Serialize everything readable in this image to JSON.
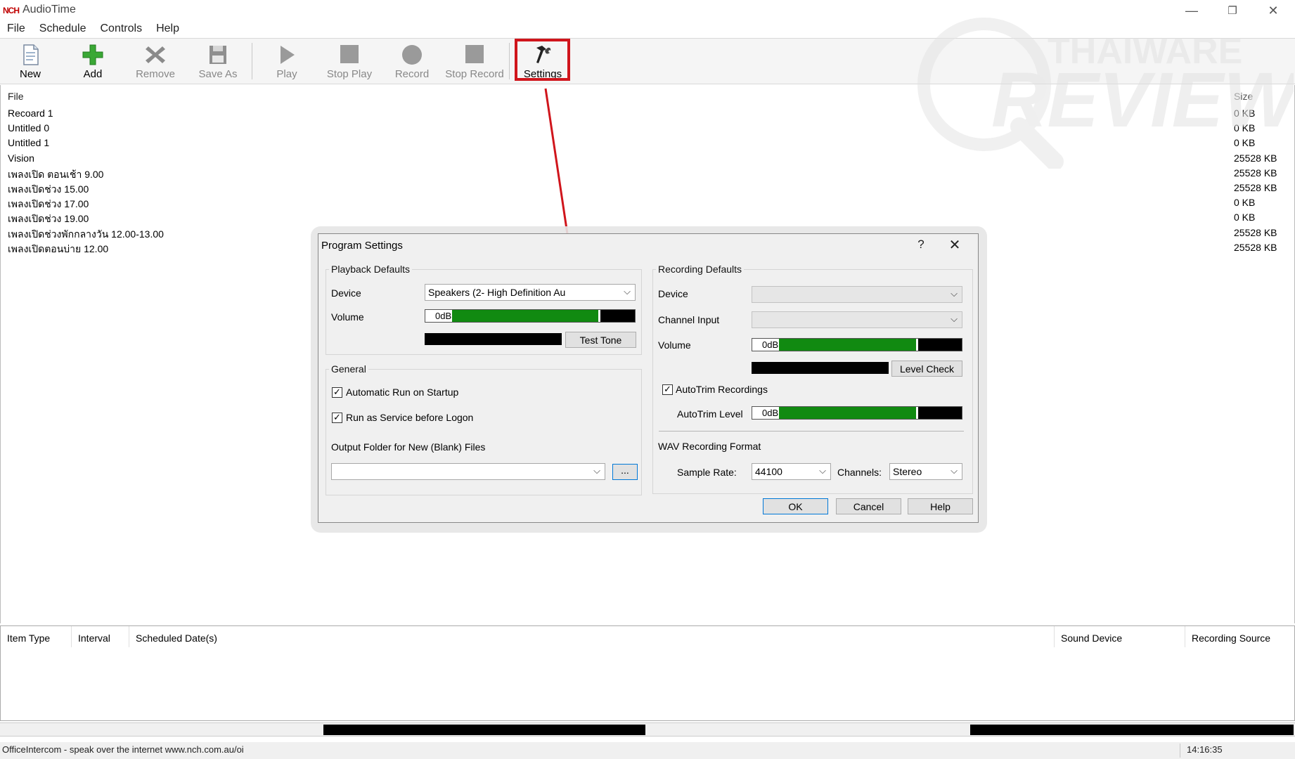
{
  "window": {
    "logo": "NCH",
    "title": "AudioTime",
    "minimize_glyph": "—",
    "restore_glyph": "❐",
    "close_glyph": "✕"
  },
  "menu": [
    "File",
    "Schedule",
    "Controls",
    "Help"
  ],
  "toolbar": {
    "new": "New",
    "add": "Add",
    "remove": "Remove",
    "save_as": "Save As",
    "play": "Play",
    "stop_play": "Stop Play",
    "record": "Record",
    "stop_record": "Stop Record",
    "settings": "Settings"
  },
  "file_list": {
    "col_file": "File",
    "col_size": "Size",
    "rows": [
      {
        "name": "Recoard 1",
        "size": "0 KB"
      },
      {
        "name": "Untitled 0",
        "size": "0 KB"
      },
      {
        "name": "Untitled 1",
        "size": "0 KB"
      },
      {
        "name": "Vision",
        "size": "25528 KB"
      },
      {
        "name": "เพลงเปิด ตอนเช้า 9.00",
        "size": "25528 KB"
      },
      {
        "name": "เพลงเปิดช่วง 15.00",
        "size": "25528 KB"
      },
      {
        "name": "เพลงเปิดช่วง 17.00",
        "size": "0 KB"
      },
      {
        "name": "เพลงเปิดช่วง 19.00",
        "size": "0 KB"
      },
      {
        "name": "เพลงเปิดช่วงพักกลางวัน 12.00-13.00",
        "size": "25528 KB"
      },
      {
        "name": "เพลงเปิดตอนบ่าย 12.00",
        "size": "25528 KB"
      }
    ]
  },
  "schedule": {
    "headers": [
      "Item Type",
      "Interval",
      "Scheduled Date(s)",
      "Sound Device",
      "Recording Source"
    ]
  },
  "status": {
    "message": "OfficeIntercom - speak over the internet www.nch.com.au/oi",
    "time": "14:16:35"
  },
  "watermark": {
    "brand": "THAIWARE",
    "word": "REVIEW"
  },
  "dialog": {
    "title": "Program Settings",
    "help_glyph": "?",
    "close_glyph": "✕",
    "playback": {
      "group": "Playback Defaults",
      "device_label": "Device",
      "device_value": "Speakers (2- High Definition Au",
      "volume_label": "Volume",
      "volume_db": "0dB",
      "volume_level": 0.81,
      "test_tone": "Test Tone"
    },
    "general": {
      "group": "General",
      "auto_run": {
        "label": "Automatic Run on Startup",
        "checked": true
      },
      "run_service": {
        "label": "Run as Service before Logon",
        "checked": true
      },
      "output_label": "Output Folder for New (Blank) Files",
      "output_value": "",
      "browse": "..."
    },
    "recording": {
      "group": "Recording Defaults",
      "device_label": "Device",
      "device_value": "",
      "channel_label": "Channel Input",
      "channel_value": "",
      "volume_label": "Volume",
      "volume_db": "0dB",
      "volume_level": 0.76,
      "level_check": "Level Check",
      "autotrim": {
        "label": "AutoTrim Recordings",
        "checked": true
      },
      "autotrim_level_label": "AutoTrim Level",
      "autotrim_db": "0dB",
      "autotrim_level": 0.76,
      "wav_label": "WAV Recording Format",
      "sample_rate_label": "Sample Rate:",
      "sample_rate_value": "44100",
      "channels_label": "Channels:",
      "channels_value": "Stereo"
    },
    "ok": "OK",
    "cancel": "Cancel",
    "help": "Help",
    "check_glyph": "✓",
    "chevron_glyph": "⌵"
  }
}
